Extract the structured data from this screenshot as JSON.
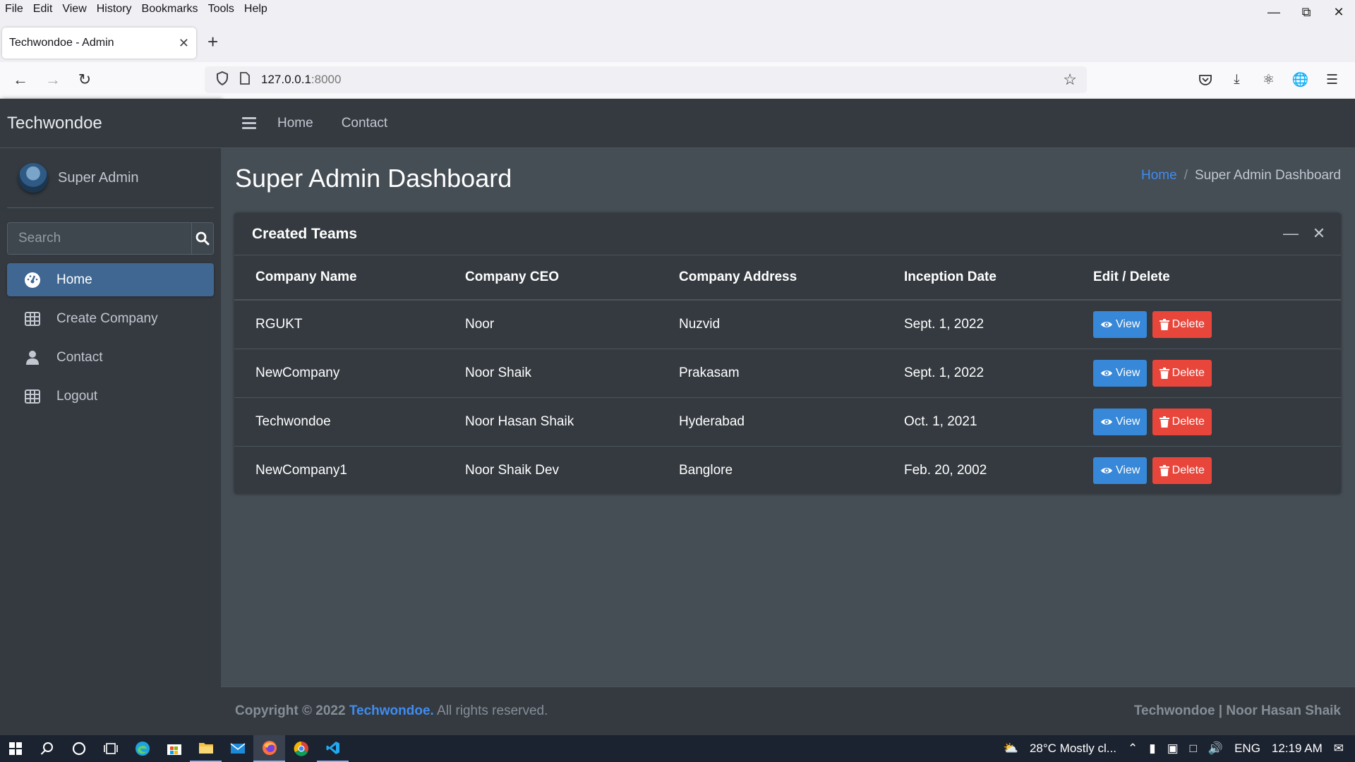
{
  "browser": {
    "menu": [
      "File",
      "Edit",
      "View",
      "History",
      "Bookmarks",
      "Tools",
      "Help"
    ],
    "tab_title": "Techwondoe - Admin",
    "url_host": "127.0.0.1",
    "url_port": ":8000"
  },
  "app": {
    "brand": "Techwondoe",
    "user_name": "Super Admin",
    "search_placeholder": "Search",
    "nav": [
      {
        "label": "Home",
        "icon": "dashboard-icon",
        "active": true
      },
      {
        "label": "Create Company",
        "icon": "grid-icon"
      },
      {
        "label": "Contact",
        "icon": "user-icon"
      },
      {
        "label": "Logout",
        "icon": "grid-icon"
      }
    ],
    "topnav": [
      "Home",
      "Contact"
    ]
  },
  "page": {
    "title": "Super Admin Dashboard",
    "breadcrumb": {
      "home": "Home",
      "separator": "/",
      "current": "Super Admin Dashboard"
    }
  },
  "card": {
    "title": "Created Teams",
    "columns": [
      "Company Name",
      "Company CEO",
      "Company Address",
      "Inception Date",
      "Edit / Delete"
    ],
    "rows": [
      {
        "name": "RGUKT",
        "ceo": "Noor",
        "address": "Nuzvid",
        "date": "Sept. 1, 2022"
      },
      {
        "name": "NewCompany",
        "ceo": "Noor Shaik",
        "address": "Prakasam",
        "date": "Sept. 1, 2022"
      },
      {
        "name": "Techwondoe",
        "ceo": "Noor Hasan Shaik",
        "address": "Hyderabad",
        "date": "Oct. 1, 2021"
      },
      {
        "name": "NewCompany1",
        "ceo": "Noor Shaik Dev",
        "address": "Banglore",
        "date": "Feb. 20, 2002"
      }
    ],
    "view_label": "View",
    "delete_label": "Delete"
  },
  "footer": {
    "copyright": "Copyright © 2022",
    "link": "Techwondoe.",
    "rights": "All rights reserved.",
    "right_text": "Techwondoe | Noor Hasan Shaik"
  },
  "taskbar": {
    "weather": "28°C  Mostly cl...",
    "lang": "ENG",
    "time": "12:19 AM"
  },
  "colors": {
    "sidebar_bg": "#343a40",
    "content_bg": "#454d55",
    "active_nav": "#3f6791",
    "link": "#3f8cf0",
    "view_btn": "#3788d8",
    "delete_btn": "#e8463b"
  }
}
